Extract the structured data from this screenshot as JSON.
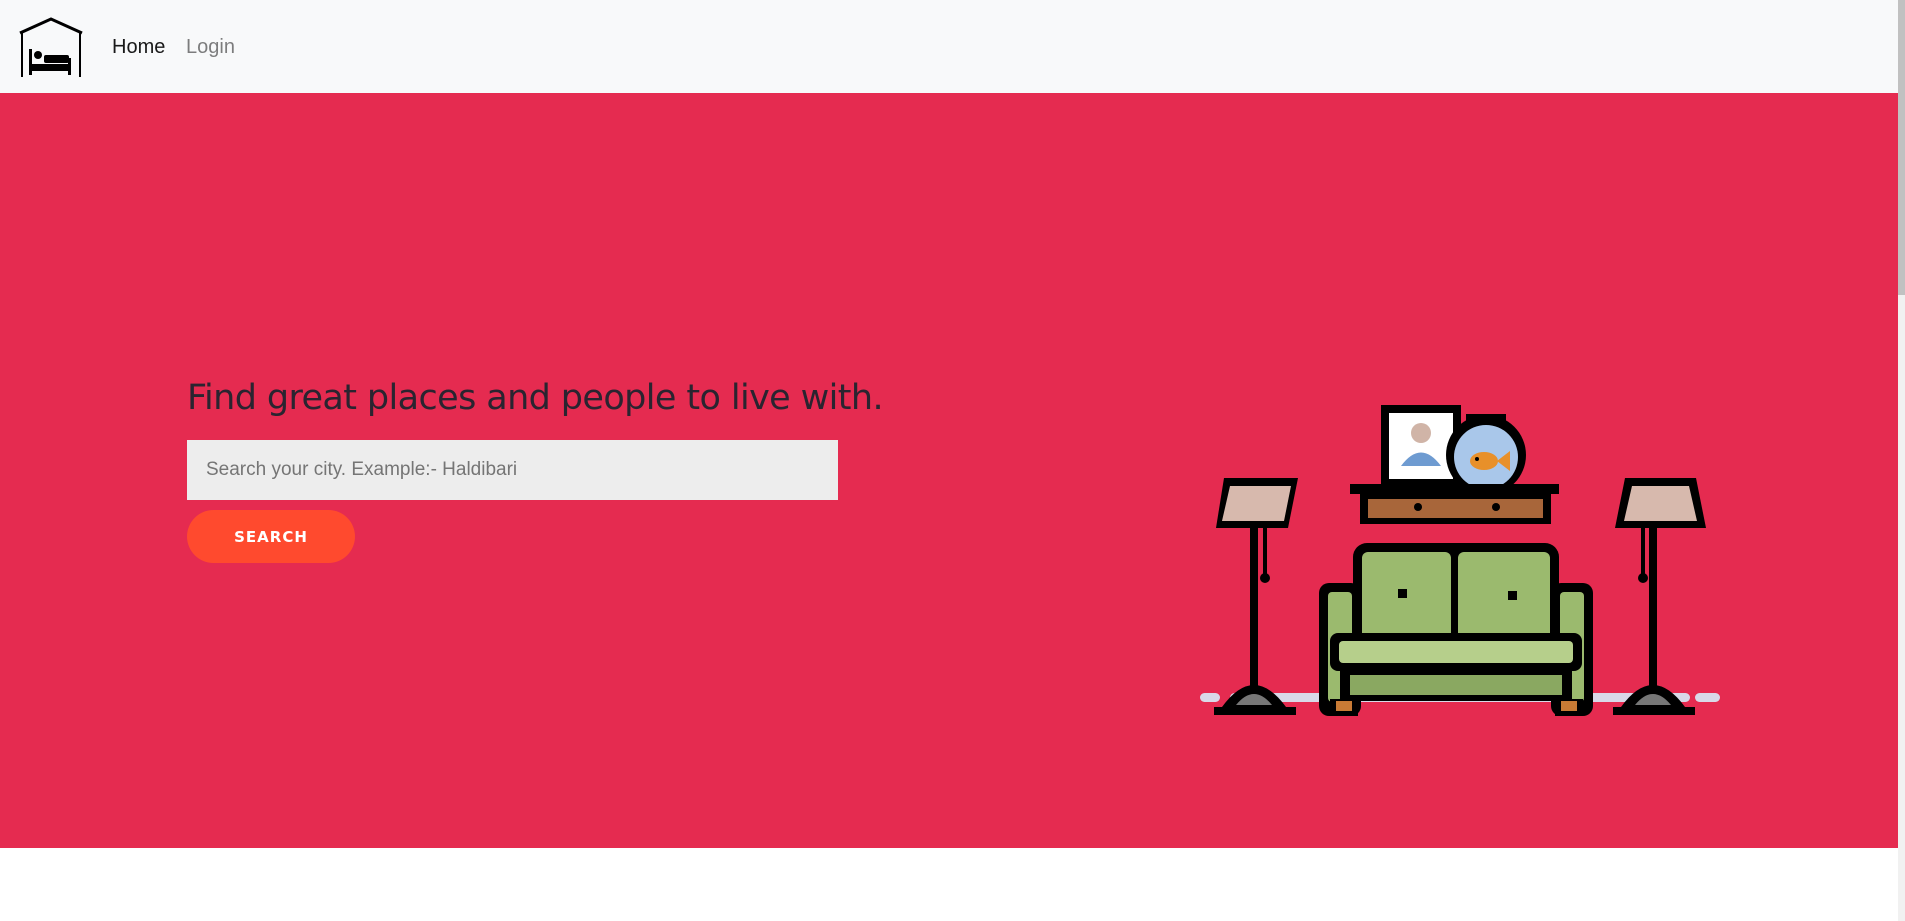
{
  "nav": {
    "logo_icon": "house-bed-icon",
    "home_label": "Home",
    "login_label": "Login"
  },
  "hero": {
    "background_color": "#e52b50",
    "headline": "Find great places and people to live with.",
    "search": {
      "placeholder": "Search your city. Example:- Haldibari",
      "value": ""
    },
    "search_button_label": "SEARCH",
    "button_color": "#ff4a2e",
    "illustration": "living-room-sofa-illustration"
  }
}
